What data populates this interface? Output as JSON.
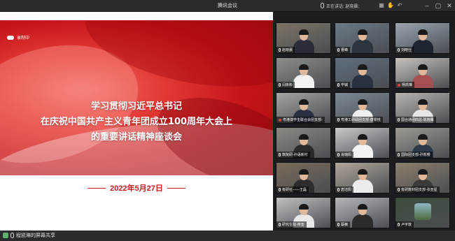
{
  "window": {
    "title": "腾讯会议",
    "speaking_label": "正在讲话: 赵晓晨;"
  },
  "recording": {
    "label": "录制中"
  },
  "slide": {
    "title_line1": "学习贯彻习近平总书记",
    "title_line2": "在庆祝中国共产主义青年团成立100周年大会上",
    "title_line3": "的重要讲话精神座谈会",
    "date": "2022年5月27日"
  },
  "status": {
    "share_text": "程凯琳的屏幕共享"
  },
  "participants": [
    {
      "name": "赵晓晨",
      "mic": "on"
    },
    {
      "name": "曹峰",
      "mic": "on"
    },
    {
      "name": "刘晓仕",
      "mic": "on"
    },
    {
      "name": "闫彬彬",
      "mic": "on"
    },
    {
      "name": "毕铖",
      "mic": "on"
    },
    {
      "name": "杨凯琳",
      "mic": "muted"
    },
    {
      "name": "粤港澳学生联合会团支部-",
      "mic": "muted"
    },
    {
      "name": "粤港工研硕团支部-唐梁悦",
      "mic": "on"
    },
    {
      "name": "国合通团四总-陈婉鹰",
      "mic": "on"
    },
    {
      "name": "数院研-孙语新村",
      "mic": "on"
    },
    {
      "name": "肖璐阳",
      "mic": "on"
    },
    {
      "name": "国际团支部-孙凯樱",
      "mic": "on"
    },
    {
      "name": "有研社——王磊",
      "mic": "on"
    },
    {
      "name": "唐洁阳",
      "mic": "on"
    },
    {
      "name": "有研数材团支部-张亚星",
      "mic": "on"
    },
    {
      "name": "研究生院-蒋奎",
      "mic": "on"
    },
    {
      "name": "蔡薇",
      "mic": "on"
    },
    {
      "name": "卢宇敦",
      "mic": "on"
    }
  ],
  "colors": {
    "slide_red": "#c4141a",
    "date_red": "#c51d1d",
    "titlebar": "#2a2b2f",
    "muted_red": "#e04242"
  },
  "icons": [
    "mic-icon",
    "cloud-icon",
    "share-screen-icon",
    "minimize-icon",
    "maximize-icon",
    "close-icon",
    "back-icon"
  ]
}
